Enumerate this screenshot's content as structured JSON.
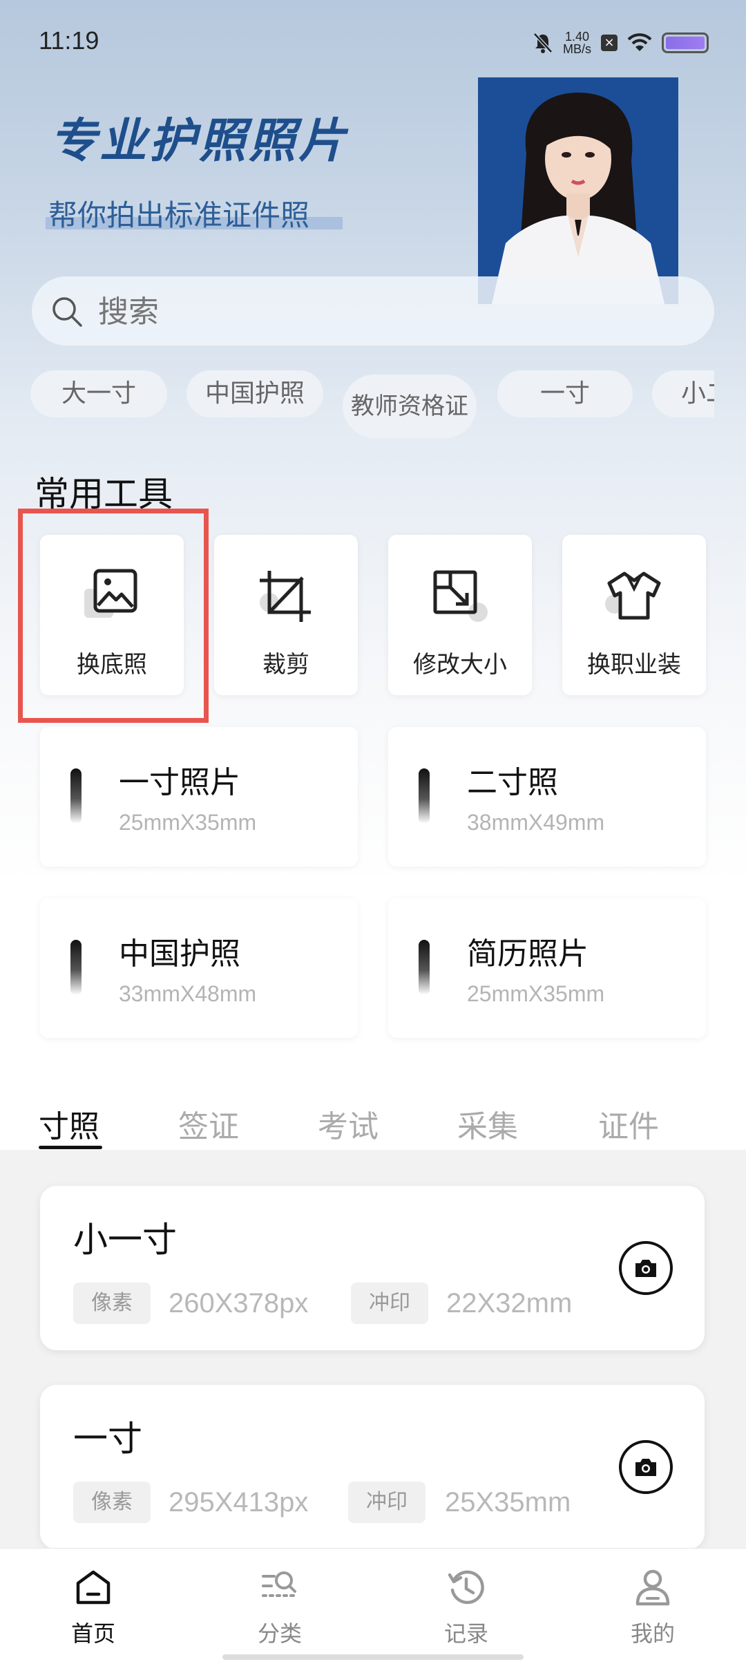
{
  "status_bar": {
    "time": "11:19",
    "net_speed_value": "1.40",
    "net_speed_unit": "MB/s"
  },
  "hero": {
    "title": "专业护照照片",
    "subtitle": "帮你拍出标准证件照"
  },
  "search": {
    "placeholder": "搜索"
  },
  "quick_tags": [
    "大一寸",
    "中国护照",
    "教师资格证",
    "一寸",
    "小二寸"
  ],
  "tools_section": {
    "title": "常用工具"
  },
  "tools": [
    {
      "label": "换底照",
      "icon": "image-icon",
      "highlighted": true
    },
    {
      "label": "裁剪",
      "icon": "crop-icon"
    },
    {
      "label": "修改大小",
      "icon": "resize-icon"
    },
    {
      "label": "换职业装",
      "icon": "shirt-icon"
    }
  ],
  "size_cards": [
    {
      "name": "一寸照片",
      "dimension": "25mmX35mm"
    },
    {
      "name": "二寸照",
      "dimension": "38mmX49mm"
    },
    {
      "name": "中国护照",
      "dimension": "33mmX48mm"
    },
    {
      "name": "简历照片",
      "dimension": "25mmX35mm"
    }
  ],
  "category_tabs": [
    {
      "label": "寸照",
      "active": true
    },
    {
      "label": "签证"
    },
    {
      "label": "考试"
    },
    {
      "label": "采集"
    },
    {
      "label": "证件"
    }
  ],
  "spec_list": [
    {
      "name": "小一寸",
      "pixel_label": "像素",
      "pixel_value": "260X378px",
      "print_label": "冲印",
      "print_value": "22X32mm"
    },
    {
      "name": "一寸",
      "pixel_label": "像素",
      "pixel_value": "295X413px",
      "print_label": "冲印",
      "print_value": "25X35mm"
    }
  ],
  "bottom_nav": [
    {
      "label": "首页",
      "icon": "home-icon",
      "active": true
    },
    {
      "label": "分类",
      "icon": "category-icon"
    },
    {
      "label": "记录",
      "icon": "history-icon"
    },
    {
      "label": "我的",
      "icon": "profile-icon"
    }
  ],
  "colors": {
    "accent": "#1e4f8c",
    "highlight_border": "#e8554e",
    "portrait_bg": "#1c4e98"
  }
}
